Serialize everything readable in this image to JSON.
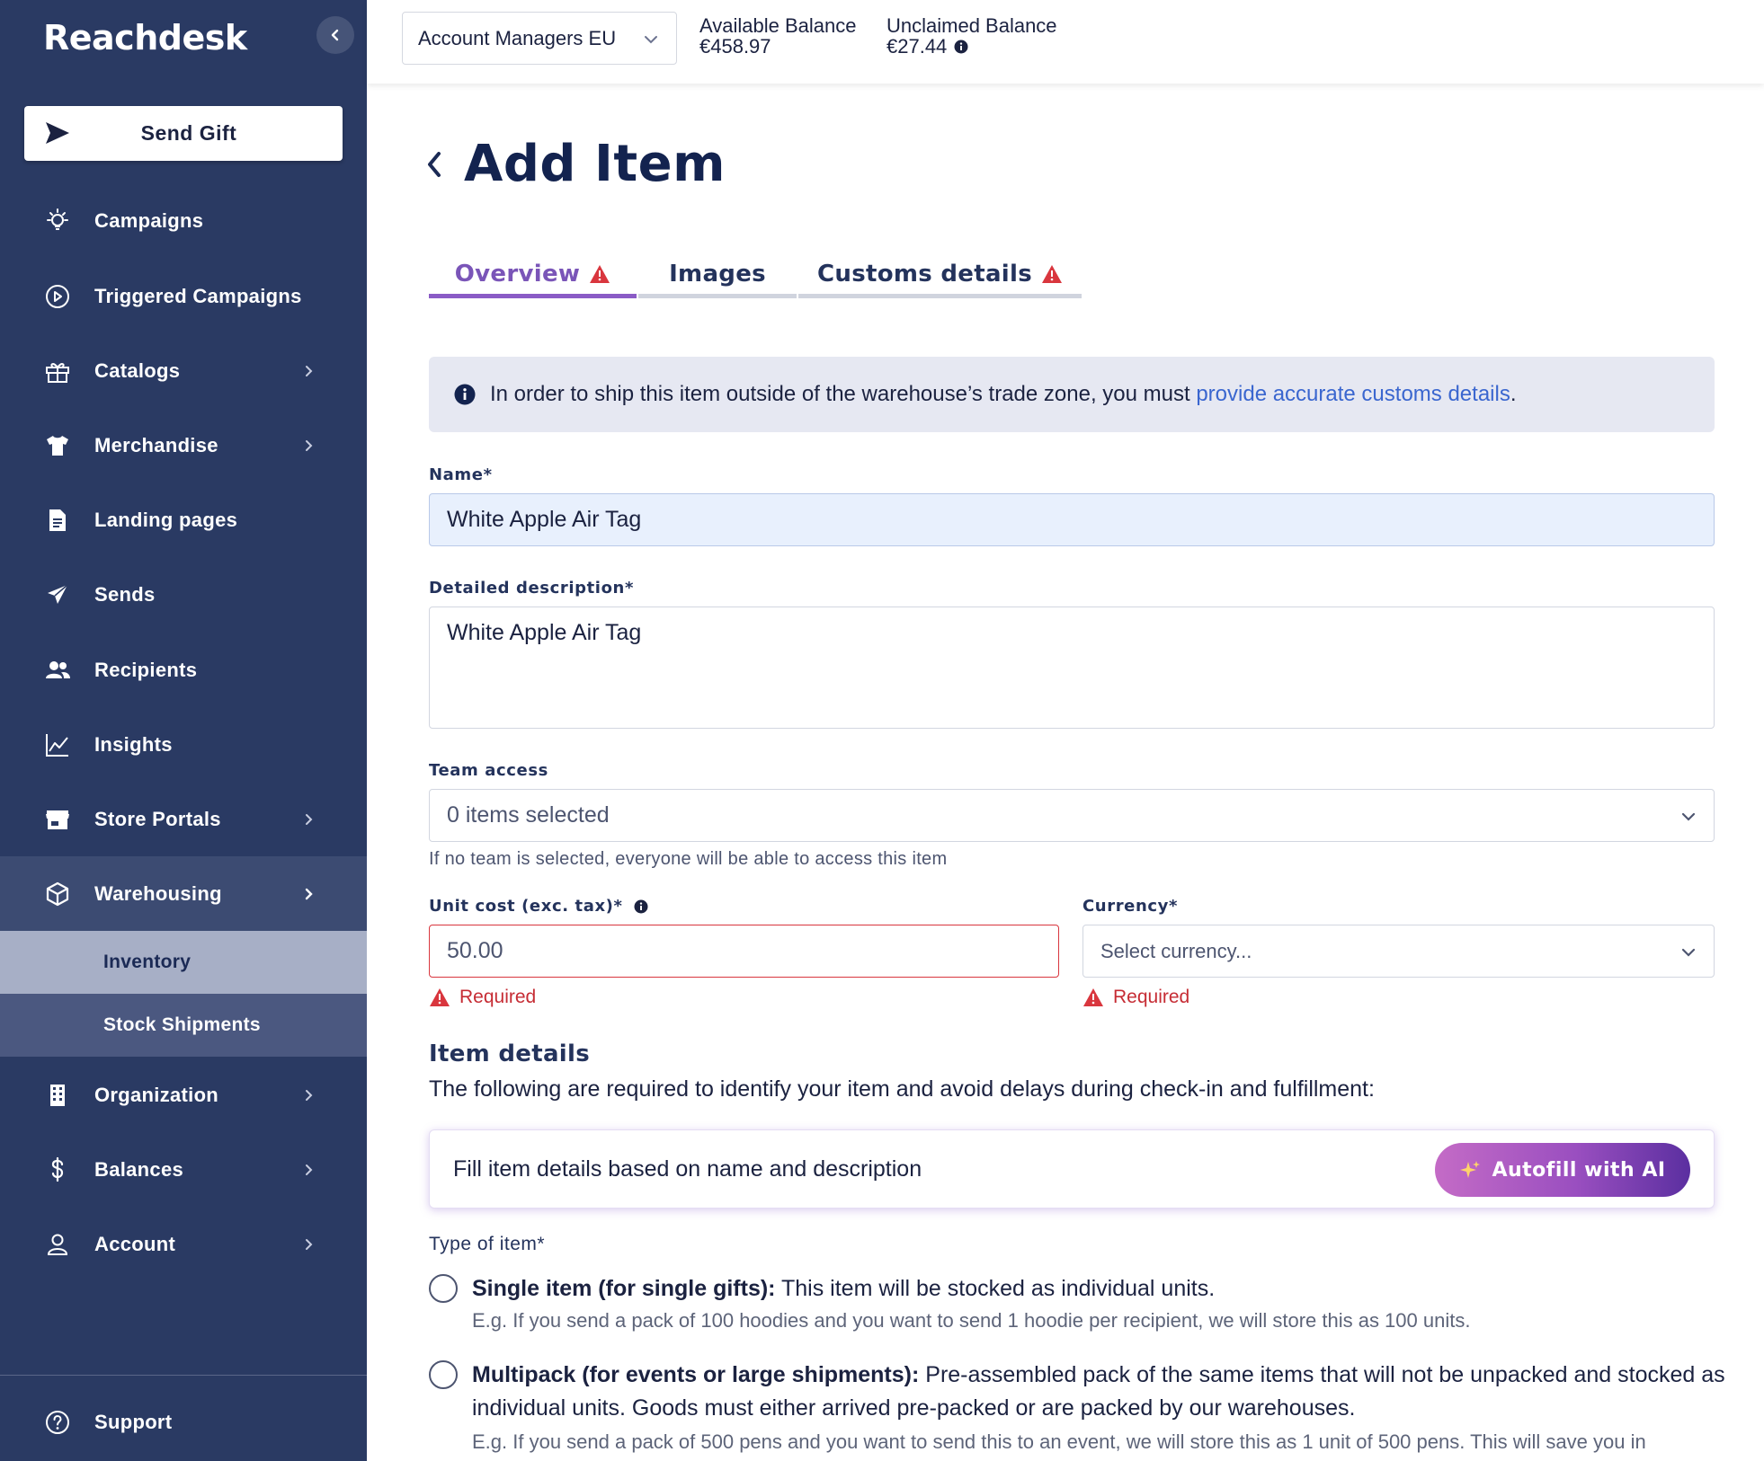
{
  "sidebar": {
    "logo": "Reachdesk",
    "send_gift": "Send Gift",
    "items": [
      {
        "label": "Campaigns"
      },
      {
        "label": "Triggered Campaigns"
      },
      {
        "label": "Catalogs"
      },
      {
        "label": "Merchandise"
      },
      {
        "label": "Landing pages"
      },
      {
        "label": "Sends"
      },
      {
        "label": "Recipients"
      },
      {
        "label": "Insights"
      },
      {
        "label": "Store Portals"
      },
      {
        "label": "Warehousing"
      },
      {
        "label": "Organization"
      },
      {
        "label": "Balances"
      },
      {
        "label": "Account"
      }
    ],
    "warehousing_sub": [
      {
        "label": "Inventory"
      },
      {
        "label": "Stock Shipments"
      }
    ],
    "support": "Support"
  },
  "topbar": {
    "account_select": "Account Managers EU",
    "available_label": "Available Balance",
    "available_value": "€458.97",
    "unclaimed_label": "Unclaimed Balance",
    "unclaimed_value": "€27.44"
  },
  "page": {
    "title": "Add Item",
    "tabs": [
      {
        "label": "Overview",
        "warning": true,
        "active": true
      },
      {
        "label": "Images",
        "warning": false,
        "active": false
      },
      {
        "label": "Customs details",
        "warning": true,
        "active": false
      }
    ],
    "info": {
      "text": "In order to ship this item outside of the warehouse’s trade zone, you must ",
      "link": "provide accurate customs details",
      "suffix": "."
    }
  },
  "form": {
    "name_label": "Name*",
    "name_value": "White Apple Air Tag",
    "desc_label": "Detailed description*",
    "desc_value": "White Apple Air Tag",
    "team_label": "Team access",
    "team_value": "0 items selected",
    "team_helper": "If no team is selected, everyone will be able to access this item",
    "unit_cost_label": "Unit cost (exc. tax)*",
    "unit_cost_value": "50.00",
    "unit_cost_error": "Required",
    "currency_label": "Currency*",
    "currency_placeholder": "Select currency...",
    "currency_error": "Required"
  },
  "item_details": {
    "title": "Item details",
    "description": "The following are required to identify your item and avoid delays during check-in and fulfillment:",
    "autofill_text": "Fill item details based on name and description",
    "autofill_button": "Autofill with AI",
    "type_label": "Type of item*",
    "options": [
      {
        "title": "Single item (for single gifts):",
        "text": " This item will be stocked as individual units.",
        "example": "E.g. If you send a pack of 100 hoodies and you want to send 1 hoodie per recipient, we will store this as 100 units."
      },
      {
        "title": "Multipack (for events or large shipments):",
        "text": " Pre-assembled pack of the same items that will not be unpacked and stocked as individual units. Goods must either arrived pre-packed or are packed by our warehouses.",
        "example": "E.g. If you send a pack of 500 pens and you want to send this to an event, we will store this as 1 unit of 500 pens. This will save you in"
      }
    ]
  },
  "colors": {
    "sidebar_bg": "#2a3a63",
    "accent_purple": "#7a55b8",
    "error_red": "#c62c34",
    "link_blue": "#3a66cf"
  }
}
